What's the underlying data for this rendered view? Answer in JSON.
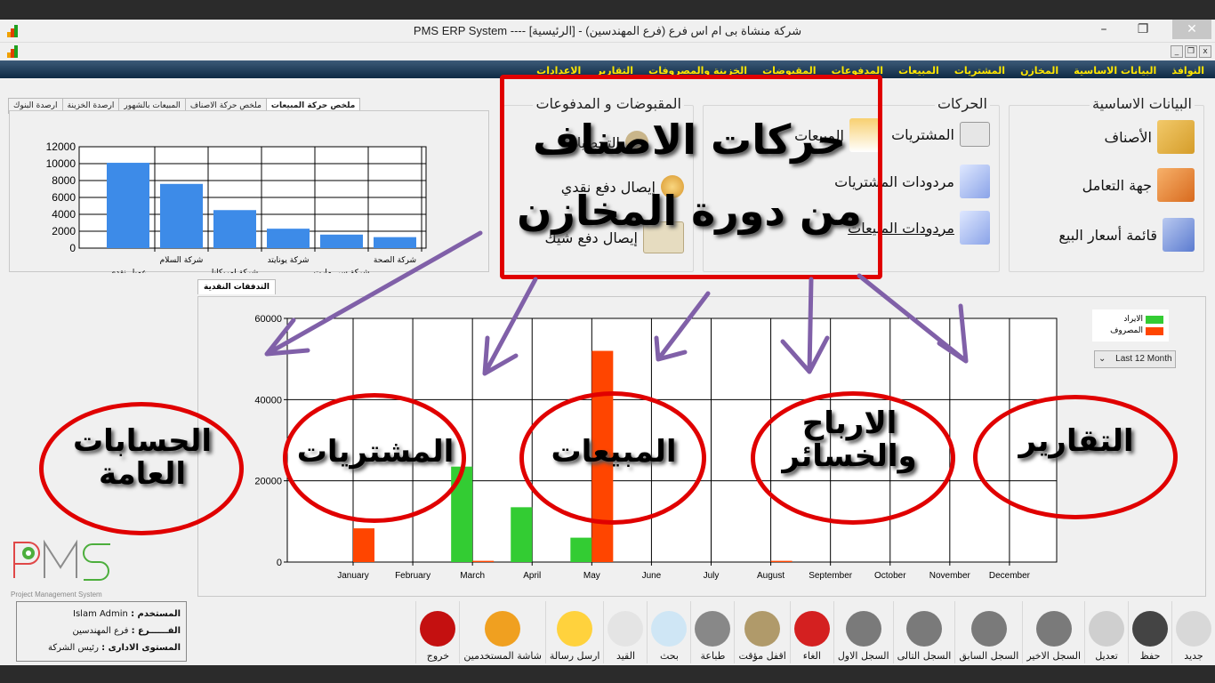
{
  "window": {
    "title": "PMS ERP System ----  شركة منشاة بى ام اس فرع (فرع المهندسين) - [الرئيسية]",
    "minimize": "–",
    "maximize": "❐",
    "close": "✕",
    "mdi_minimize": "_",
    "mdi_restore": "❐",
    "mdi_close": "x"
  },
  "menu": [
    "النوافذ",
    "البيانات الاساسية",
    "المخازن",
    "المشتريات",
    "المبيعات",
    "المدفوعات",
    "المقبوضات",
    "الخزينة والمصروفات",
    "التقارير",
    "الاعدادات"
  ],
  "summary_tabs": {
    "items": [
      "ملخص حركة المبيعات",
      "ملخص حركة الاصناف",
      "المبيعات بالشهور",
      "ارصدة الخزينة",
      "ارصدة البنوك"
    ],
    "active": 0
  },
  "groups": {
    "basic": {
      "title": "البيانات الاساسية",
      "items": [
        {
          "label": "الأصناف",
          "icon": "items-box-icon"
        },
        {
          "label": "جهة التعامل",
          "icon": "contact-folder-icon"
        },
        {
          "label": "قائمة أسعار البيع",
          "icon": "price-list-icon"
        }
      ]
    },
    "movements": {
      "title": "الحركات",
      "items": [
        {
          "label": "المشتريات",
          "icon": "purchase-order-icon"
        },
        {
          "label": "المبيعات",
          "icon": "sales-invoice-icon"
        },
        {
          "label": "مردودات المشتريات",
          "icon": "purchase-returns-icon"
        },
        {
          "label": "مردودات المبيعات",
          "icon": "sales-returns-icon"
        }
      ]
    },
    "receipts": {
      "title": "المقبوضات و المدفوعات",
      "items": [
        {
          "label": "التحصيلات",
          "icon": "collections-icon"
        },
        {
          "label": "إيصال دفع نقدي",
          "icon": "cash-payment-icon"
        },
        {
          "label": "إيصال دفع شيك",
          "icon": "cheque-payment-icon"
        }
      ]
    }
  },
  "cash_tab": "التدفقات النقدية",
  "legend": [
    {
      "label": "الايراد",
      "color": "#33cc33"
    },
    {
      "label": "المصروف",
      "color": "#ff4500"
    }
  ],
  "range_select": {
    "value": "Last 12 Month",
    "caret": "⌄"
  },
  "chart_data": [
    {
      "type": "bar",
      "title": "ملخص حركة المبيعات",
      "categories": [
        "عميل نقدى",
        "شركة السلام",
        "شركة امريكانا",
        "شركة يونايتد",
        "شركة سى مارت",
        "شركة الصحة"
      ],
      "values": [
        10100,
        7600,
        4500,
        2300,
        1600,
        1300
      ],
      "ylim": [
        0,
        12000
      ],
      "yticks": [
        0,
        2000,
        4000,
        6000,
        8000,
        10000,
        12000
      ],
      "grid": true,
      "color": "#3d8be8",
      "xlabel": "",
      "ylabel": ""
    },
    {
      "type": "bar",
      "title": "التدفقات النقدية",
      "categories": [
        "January",
        "February",
        "March",
        "April",
        "May",
        "June",
        "July",
        "August",
        "September",
        "October",
        "November",
        "December"
      ],
      "series": [
        {
          "name": "الايراد",
          "values": [
            0,
            0,
            23500,
            13500,
            6000,
            0,
            0,
            0,
            0,
            0,
            0,
            0
          ],
          "color": "#33cc33"
        },
        {
          "name": "المصروف",
          "values": [
            8300,
            0,
            300,
            0,
            52000,
            0,
            0,
            300,
            0,
            0,
            0,
            0
          ],
          "color": "#ff4500"
        }
      ],
      "ylim": [
        0,
        60000
      ],
      "yticks": [
        0,
        20000,
        40000,
        60000
      ],
      "grid": true,
      "legend": "top-right",
      "xlabel": "",
      "ylabel": ""
    }
  ],
  "user_info": {
    "user_label": "المستخدم :",
    "user_value": "Islam Admin",
    "branch_label": "الفــــــرع :",
    "branch_value": "فرع المهندسين",
    "level_label": "المستوى الادارى :",
    "level_value": "رئيس الشركة"
  },
  "logo": {
    "text": "PMS",
    "subtitle": "Project Management System"
  },
  "toolbar": [
    {
      "label": "جديد",
      "icon": "new-doc-icon",
      "color": "#d8d8d8"
    },
    {
      "label": "حفظ",
      "icon": "save-disk-icon",
      "color": "#444"
    },
    {
      "label": "تعديل",
      "icon": "edit-refresh-icon",
      "color": "#cfcfcf"
    },
    {
      "label": "السجل الاخير",
      "icon": "last-record-icon",
      "color": "#7a7a7a"
    },
    {
      "label": "السجل السابق",
      "icon": "previous-record-icon",
      "color": "#7a7a7a"
    },
    {
      "label": "السجل التالى",
      "icon": "next-record-icon",
      "color": "#7a7a7a"
    },
    {
      "label": "السجل الاول",
      "icon": "first-record-icon",
      "color": "#7a7a7a"
    },
    {
      "label": "الغاء",
      "icon": "cancel-bin-icon",
      "color": "#d42020"
    },
    {
      "label": "اقفل مؤقت",
      "icon": "lock-icon",
      "color": "#b09a6a"
    },
    {
      "label": "طباعة",
      "icon": "printer-icon",
      "color": "#888"
    },
    {
      "label": "بحث",
      "icon": "search-icon",
      "color": "#cfe6f5"
    },
    {
      "label": "القيد",
      "icon": "journal-book-icon",
      "color": "#e4e4e4"
    },
    {
      "label": "ارسل رسالة",
      "icon": "mail-icon",
      "color": "#ffd23d"
    },
    {
      "label": "شاشة المستخدمين",
      "icon": "users-icon",
      "color": "#f0a020"
    },
    {
      "label": "خروج",
      "icon": "exit-icon",
      "color": "#c41010"
    }
  ],
  "annotations": {
    "headline_1": "حركات الاصناف",
    "headline_2": "من دورة المخازن",
    "circles": [
      "الحسابات العامة",
      "المشتريات",
      "المبيعات",
      "الارباح والخسائر",
      "التقارير"
    ]
  }
}
